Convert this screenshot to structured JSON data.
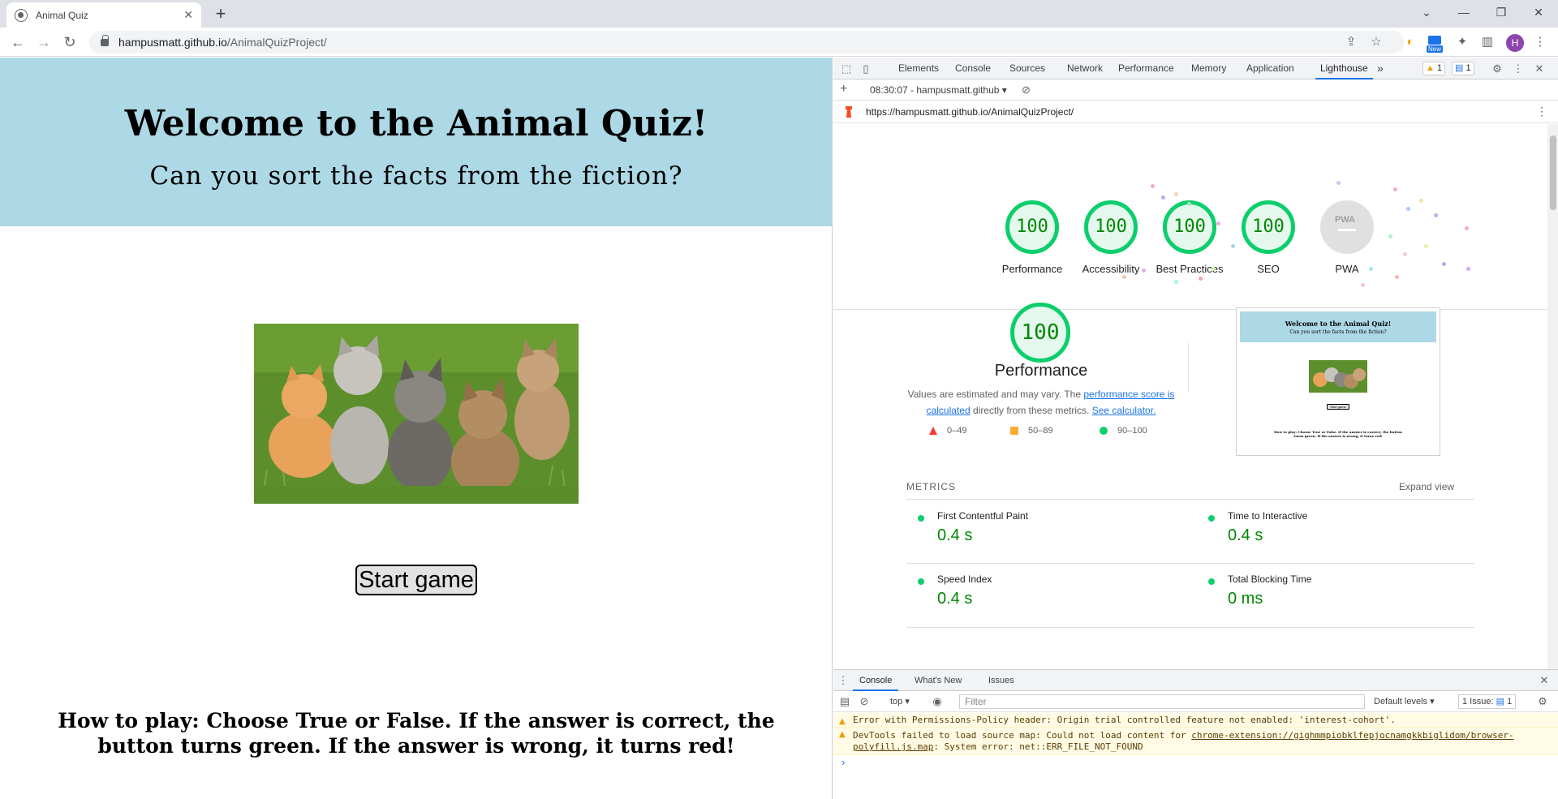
{
  "browser": {
    "tab_title": "Animal Quiz",
    "tab_close": "✕",
    "new_tab": "+",
    "url_host": "hampusmatt.github.io",
    "url_path": "/AnimalQuizProject/",
    "profile_initial": "H",
    "new_badge": "New"
  },
  "page": {
    "title": "Welcome to the Animal Quiz!",
    "subtitle": "Can you sort the facts from the fiction?",
    "image_alt": "kittens",
    "start_button": "Start game",
    "instructions": "How to play: Choose True or False. If the answer is correct, the button turns green. If the answer is wrong, it turns red!"
  },
  "devtools": {
    "tabs": [
      "Elements",
      "Console",
      "Sources",
      "Network",
      "Performance",
      "Memory",
      "Application",
      "Lighthouse"
    ],
    "active_tab": "Lighthouse",
    "more_tabs": "»",
    "warnings_count": "1",
    "messages_count": "1",
    "report_selector": "08:30:07 - hampusmatt.github",
    "report_url": "https://hampusmatt.github.io/AnimalQuizProject/",
    "gauges": [
      {
        "label": "Performance",
        "score": "100"
      },
      {
        "label": "Accessibility",
        "score": "100"
      },
      {
        "label": "Best Practices",
        "score": "100"
      },
      {
        "label": "SEO",
        "score": "100"
      },
      {
        "label": "PWA",
        "score": ""
      }
    ],
    "pwa_text": "PWA",
    "performance": {
      "score": "100",
      "title": "Performance",
      "desc_prefix": "Values are estimated and may vary. The ",
      "desc_link1": "performance score is calculated",
      "desc_mid": " directly from these metrics. ",
      "desc_link2": "See calculator.",
      "legend": [
        {
          "range": "0–49",
          "color": "#ff3333"
        },
        {
          "range": "50–89",
          "color": "#ffaa33"
        },
        {
          "range": "90–100",
          "color": "#0cce6b"
        }
      ]
    },
    "thumbnail": {
      "title": "Welcome to the Animal Quiz!",
      "subtitle": "Can you sort the facts from the fiction?",
      "button": "Start game",
      "text": "How to play: Choose True or False. If the answer is correct, the button turns green. If the answer is wrong, it turns red!"
    },
    "metrics_label": "METRICS",
    "expand_view": "Expand view",
    "metrics": [
      {
        "name": "First Contentful Paint",
        "value": "0.4 s"
      },
      {
        "name": "Time to Interactive",
        "value": "0.4 s"
      },
      {
        "name": "Speed Index",
        "value": "0.4 s"
      },
      {
        "name": "Total Blocking Time",
        "value": "0 ms"
      }
    ],
    "drawer_tabs": [
      "Console",
      "What's New",
      "Issues"
    ],
    "console": {
      "context": "top",
      "filter_placeholder": "Filter",
      "levels": "Default levels",
      "issues_label": "1 Issue:",
      "issues_count": "1",
      "messages": [
        {
          "text": "Error with Permissions-Policy header: Origin trial controlled feature not enabled: 'interest-cohort'."
        },
        {
          "prefix": "DevTools failed to load source map: Could not load content for ",
          "link": "chrome-extension://gighmmpiobklfepjocnamgkkbiglidom/browser-polyfill.js.map",
          "suffix": ": System error: net::ERR_FILE_NOT_FOUND"
        }
      ],
      "prompt": "›"
    }
  }
}
